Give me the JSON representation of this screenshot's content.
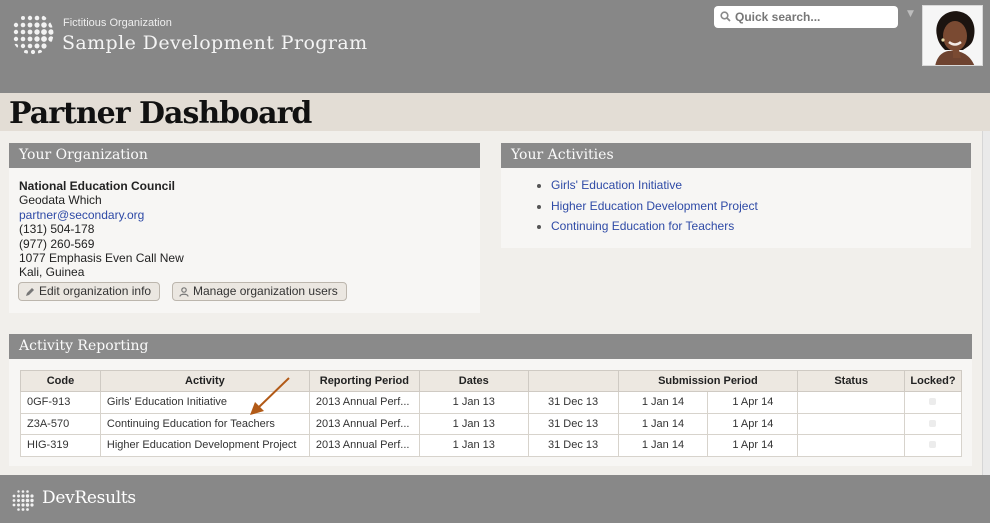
{
  "header": {
    "org_subtitle": "Fictitious Organization",
    "program_name": "Sample Development Program",
    "search_placeholder": "Quick search..."
  },
  "page": {
    "title": "Partner Dashboard"
  },
  "your_organization": {
    "heading": "Your Organization",
    "name": "National Education Council",
    "lines": [
      "Geodata Which"
    ],
    "email": "partner@secondary.org",
    "phone1": "(131) 504-178",
    "phone2": "(977) 260-569",
    "address1": "1077 Emphasis Even Call New",
    "address2": "Kali, Guinea",
    "edit_button": "Edit organization info",
    "manage_button": "Manage organization users"
  },
  "your_activities": {
    "heading": "Your Activities",
    "items": [
      "Girls' Education Initiative",
      "Higher Education Development Project",
      "Continuing Education for Teachers"
    ]
  },
  "activity_reporting": {
    "heading": "Activity Reporting",
    "columns": {
      "code": "Code",
      "activity": "Activity",
      "reporting_period": "Reporting Period",
      "dates": "Dates",
      "submission_period": "Submission Period",
      "status": "Status",
      "locked": "Locked?"
    },
    "rows": [
      {
        "code": "0GF-913",
        "activity": "Girls' Education Initiative",
        "period": "2013 Annual Perf...",
        "date_start": "1 Jan 13",
        "date_end": "31 Dec 13",
        "sub_start": "1 Jan 14",
        "sub_end": "1 Apr 14",
        "status": ""
      },
      {
        "code": "Z3A-570",
        "activity": "Continuing Education for Teachers",
        "period": "2013 Annual Perf...",
        "date_start": "1 Jan 13",
        "date_end": "31 Dec 13",
        "sub_start": "1 Jan 14",
        "sub_end": "1 Apr 14",
        "status": ""
      },
      {
        "code": "HIG-319",
        "activity": "Higher Education Development Project",
        "period": "2013 Annual Perf...",
        "date_start": "1 Jan 13",
        "date_end": "31 Dec 13",
        "sub_start": "1 Jan 14",
        "sub_end": "1 Apr 14",
        "status": ""
      }
    ]
  },
  "footer": {
    "brand": "DevResults"
  },
  "colors": {
    "header_bg": "#878787",
    "title_bar_bg": "#e3ddd5",
    "panel_head_bg": "#8a8a8a",
    "link": "#2e4aa6",
    "annotation_arrow": "#b25a17"
  }
}
